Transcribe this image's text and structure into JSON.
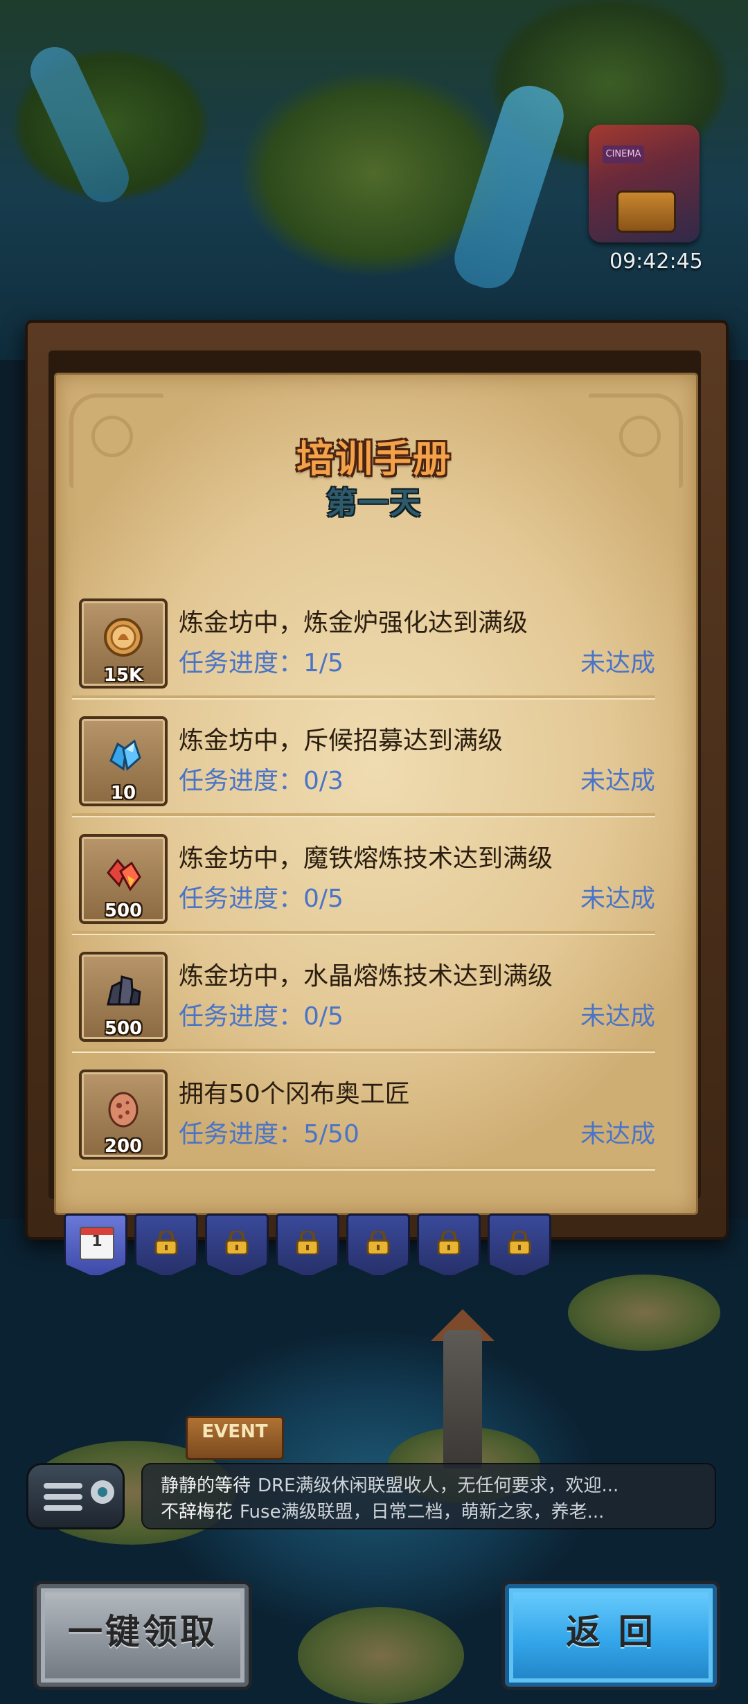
{
  "clock": "09:42:45",
  "cinema_label": "CINEMA",
  "event_sign": "EVENT",
  "title": "培训手册",
  "subtitle": "第一天",
  "tasks": [
    {
      "desc": "炼金坊中，炼金炉强化达到满级",
      "progress": "任务进度：1/5",
      "status": "未达成",
      "reward_amount": "15K",
      "reward_icon": "gold-coin-icon"
    },
    {
      "desc": "炼金坊中，斥候招募达到满级",
      "progress": "任务进度：0/3",
      "status": "未达成",
      "reward_amount": "10",
      "reward_icon": "blue-crystal-icon"
    },
    {
      "desc": "炼金坊中，魔铁熔炼技术达到满级",
      "progress": "任务进度：0/5",
      "status": "未达成",
      "reward_amount": "500",
      "reward_icon": "red-crystal-icon"
    },
    {
      "desc": "炼金坊中，水晶熔炼技术达到满级",
      "progress": "任务进度：0/5",
      "status": "未达成",
      "reward_amount": "500",
      "reward_icon": "dark-crystal-icon"
    },
    {
      "desc": "拥有50个冈布奥工匠",
      "progress": "任务进度：5/50",
      "status": "未达成",
      "reward_amount": "200",
      "reward_icon": "egg-icon"
    }
  ],
  "day_tabs": [
    {
      "icon": "calendar-icon",
      "label": "1",
      "active": true
    },
    {
      "icon": "lock-icon",
      "active": false
    },
    {
      "icon": "lock-icon",
      "active": false
    },
    {
      "icon": "lock-icon",
      "active": false
    },
    {
      "icon": "lock-icon",
      "active": false
    },
    {
      "icon": "lock-icon",
      "active": false
    },
    {
      "icon": "lock-icon",
      "active": false
    }
  ],
  "chat": [
    {
      "user": "静静的等待",
      "message": "DRE满级休闲联盟收人，无任何要求，欢迎..."
    },
    {
      "user": "不辞梅花",
      "message": "Fuse满级联盟，日常二档，萌新之家，养老..."
    }
  ],
  "buttons": {
    "claim_all": "一键领取",
    "back": "返 回"
  },
  "colors": {
    "accent_blue": "#4a74c8",
    "title_orange": "#f3a24a",
    "parchment": "#e3c895"
  }
}
